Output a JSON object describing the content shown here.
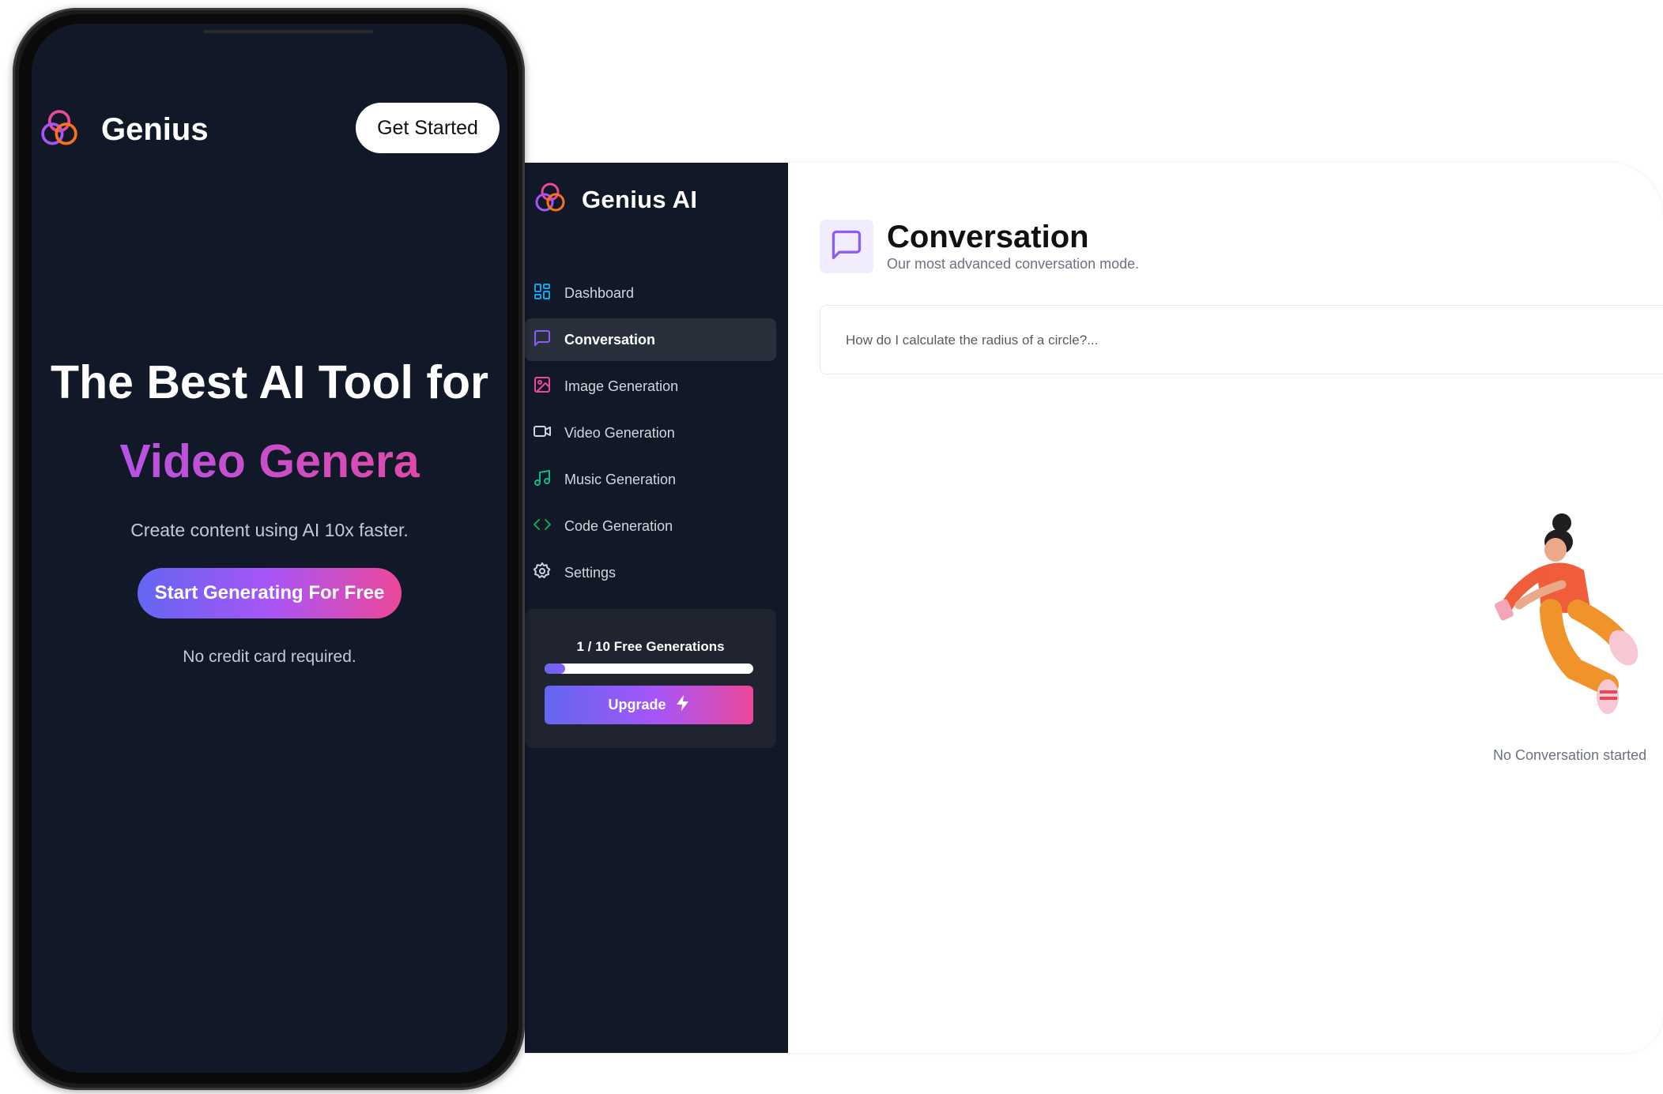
{
  "phone": {
    "brand": "Genius",
    "get_started_label": "Get Started",
    "hero_title": "The Best AI Tool for",
    "hero_typewriter": "Video Genera",
    "hero_subtitle": "Create content using AI 10x faster.",
    "cta_label": "Start Generating For Free",
    "cta_note": "No credit card required."
  },
  "sidebar": {
    "brand": "Genius AI",
    "items": [
      {
        "label": "Dashboard",
        "icon": "layout-dashboard-icon",
        "color": "#0ea5e9"
      },
      {
        "label": "Conversation",
        "icon": "message-square-icon",
        "color": "#8b5cf6",
        "active": true
      },
      {
        "label": "Image Generation",
        "icon": "image-icon",
        "color": "#ec4899"
      },
      {
        "label": "Video Generation",
        "icon": "video-icon",
        "color": "#d1d5db"
      },
      {
        "label": "Music Generation",
        "icon": "music-icon",
        "color": "#10b981"
      },
      {
        "label": "Code Generation",
        "icon": "code-icon",
        "color": "#16a34a"
      },
      {
        "label": "Settings",
        "icon": "settings-icon",
        "color": "#d1d5db"
      }
    ],
    "usage": {
      "text": "1 / 10 Free Generations",
      "used": 1,
      "limit": 10
    },
    "upgrade_label": "Upgrade"
  },
  "main": {
    "title": "Conversation",
    "subtitle": "Our most advanced conversation mode.",
    "prompt_placeholder": "How do I calculate the radius of a circle?...",
    "empty_text": "No Conversation started"
  },
  "colors": {
    "dark_bg": "#111827",
    "accent_purple": "#8b5cf6",
    "accent_pink": "#ec4899",
    "accent_indigo": "#6366f1"
  }
}
